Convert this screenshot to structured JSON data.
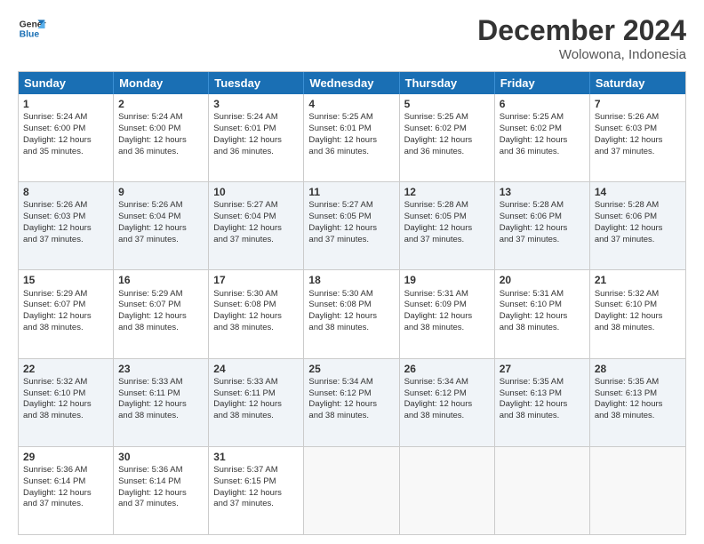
{
  "logo": {
    "line1": "General",
    "line2": "Blue"
  },
  "title": "December 2024",
  "location": "Wolowona, Indonesia",
  "days": [
    "Sunday",
    "Monday",
    "Tuesday",
    "Wednesday",
    "Thursday",
    "Friday",
    "Saturday"
  ],
  "rows": [
    [
      {
        "day": "1",
        "lines": [
          "Sunrise: 5:24 AM",
          "Sunset: 6:00 PM",
          "Daylight: 12 hours",
          "and 35 minutes."
        ]
      },
      {
        "day": "2",
        "lines": [
          "Sunrise: 5:24 AM",
          "Sunset: 6:00 PM",
          "Daylight: 12 hours",
          "and 36 minutes."
        ]
      },
      {
        "day": "3",
        "lines": [
          "Sunrise: 5:24 AM",
          "Sunset: 6:01 PM",
          "Daylight: 12 hours",
          "and 36 minutes."
        ]
      },
      {
        "day": "4",
        "lines": [
          "Sunrise: 5:25 AM",
          "Sunset: 6:01 PM",
          "Daylight: 12 hours",
          "and 36 minutes."
        ]
      },
      {
        "day": "5",
        "lines": [
          "Sunrise: 5:25 AM",
          "Sunset: 6:02 PM",
          "Daylight: 12 hours",
          "and 36 minutes."
        ]
      },
      {
        "day": "6",
        "lines": [
          "Sunrise: 5:25 AM",
          "Sunset: 6:02 PM",
          "Daylight: 12 hours",
          "and 36 minutes."
        ]
      },
      {
        "day": "7",
        "lines": [
          "Sunrise: 5:26 AM",
          "Sunset: 6:03 PM",
          "Daylight: 12 hours",
          "and 37 minutes."
        ]
      }
    ],
    [
      {
        "day": "8",
        "lines": [
          "Sunrise: 5:26 AM",
          "Sunset: 6:03 PM",
          "Daylight: 12 hours",
          "and 37 minutes."
        ]
      },
      {
        "day": "9",
        "lines": [
          "Sunrise: 5:26 AM",
          "Sunset: 6:04 PM",
          "Daylight: 12 hours",
          "and 37 minutes."
        ]
      },
      {
        "day": "10",
        "lines": [
          "Sunrise: 5:27 AM",
          "Sunset: 6:04 PM",
          "Daylight: 12 hours",
          "and 37 minutes."
        ]
      },
      {
        "day": "11",
        "lines": [
          "Sunrise: 5:27 AM",
          "Sunset: 6:05 PM",
          "Daylight: 12 hours",
          "and 37 minutes."
        ]
      },
      {
        "day": "12",
        "lines": [
          "Sunrise: 5:28 AM",
          "Sunset: 6:05 PM",
          "Daylight: 12 hours",
          "and 37 minutes."
        ]
      },
      {
        "day": "13",
        "lines": [
          "Sunrise: 5:28 AM",
          "Sunset: 6:06 PM",
          "Daylight: 12 hours",
          "and 37 minutes."
        ]
      },
      {
        "day": "14",
        "lines": [
          "Sunrise: 5:28 AM",
          "Sunset: 6:06 PM",
          "Daylight: 12 hours",
          "and 37 minutes."
        ]
      }
    ],
    [
      {
        "day": "15",
        "lines": [
          "Sunrise: 5:29 AM",
          "Sunset: 6:07 PM",
          "Daylight: 12 hours",
          "and 38 minutes."
        ]
      },
      {
        "day": "16",
        "lines": [
          "Sunrise: 5:29 AM",
          "Sunset: 6:07 PM",
          "Daylight: 12 hours",
          "and 38 minutes."
        ]
      },
      {
        "day": "17",
        "lines": [
          "Sunrise: 5:30 AM",
          "Sunset: 6:08 PM",
          "Daylight: 12 hours",
          "and 38 minutes."
        ]
      },
      {
        "day": "18",
        "lines": [
          "Sunrise: 5:30 AM",
          "Sunset: 6:08 PM",
          "Daylight: 12 hours",
          "and 38 minutes."
        ]
      },
      {
        "day": "19",
        "lines": [
          "Sunrise: 5:31 AM",
          "Sunset: 6:09 PM",
          "Daylight: 12 hours",
          "and 38 minutes."
        ]
      },
      {
        "day": "20",
        "lines": [
          "Sunrise: 5:31 AM",
          "Sunset: 6:10 PM",
          "Daylight: 12 hours",
          "and 38 minutes."
        ]
      },
      {
        "day": "21",
        "lines": [
          "Sunrise: 5:32 AM",
          "Sunset: 6:10 PM",
          "Daylight: 12 hours",
          "and 38 minutes."
        ]
      }
    ],
    [
      {
        "day": "22",
        "lines": [
          "Sunrise: 5:32 AM",
          "Sunset: 6:10 PM",
          "Daylight: 12 hours",
          "and 38 minutes."
        ]
      },
      {
        "day": "23",
        "lines": [
          "Sunrise: 5:33 AM",
          "Sunset: 6:11 PM",
          "Daylight: 12 hours",
          "and 38 minutes."
        ]
      },
      {
        "day": "24",
        "lines": [
          "Sunrise: 5:33 AM",
          "Sunset: 6:11 PM",
          "Daylight: 12 hours",
          "and 38 minutes."
        ]
      },
      {
        "day": "25",
        "lines": [
          "Sunrise: 5:34 AM",
          "Sunset: 6:12 PM",
          "Daylight: 12 hours",
          "and 38 minutes."
        ]
      },
      {
        "day": "26",
        "lines": [
          "Sunrise: 5:34 AM",
          "Sunset: 6:12 PM",
          "Daylight: 12 hours",
          "and 38 minutes."
        ]
      },
      {
        "day": "27",
        "lines": [
          "Sunrise: 5:35 AM",
          "Sunset: 6:13 PM",
          "Daylight: 12 hours",
          "and 38 minutes."
        ]
      },
      {
        "day": "28",
        "lines": [
          "Sunrise: 5:35 AM",
          "Sunset: 6:13 PM",
          "Daylight: 12 hours",
          "and 38 minutes."
        ]
      }
    ],
    [
      {
        "day": "29",
        "lines": [
          "Sunrise: 5:36 AM",
          "Sunset: 6:14 PM",
          "Daylight: 12 hours",
          "and 37 minutes."
        ]
      },
      {
        "day": "30",
        "lines": [
          "Sunrise: 5:36 AM",
          "Sunset: 6:14 PM",
          "Daylight: 12 hours",
          "and 37 minutes."
        ]
      },
      {
        "day": "31",
        "lines": [
          "Sunrise: 5:37 AM",
          "Sunset: 6:15 PM",
          "Daylight: 12 hours",
          "and 37 minutes."
        ]
      },
      null,
      null,
      null,
      null
    ]
  ]
}
